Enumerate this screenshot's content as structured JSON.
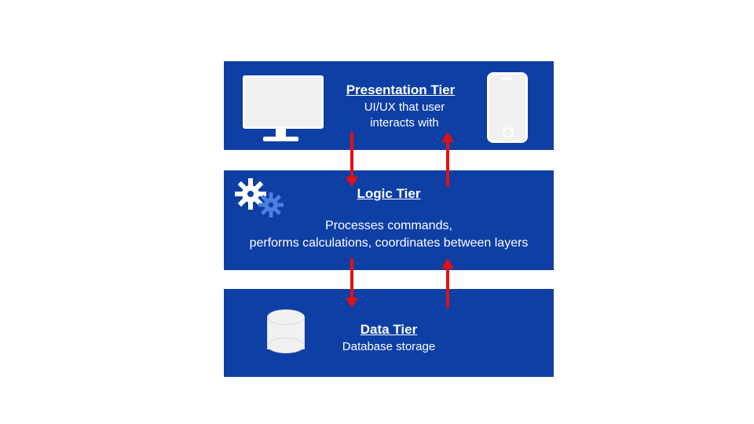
{
  "tiers": {
    "presentation": {
      "title": " Presentation Tier",
      "desc": "UI/UX that user interacts with"
    },
    "logic": {
      "title": "Logic Tier",
      "desc": "Processes commands,\nperforms calculations, coordinates between layers"
    },
    "data": {
      "title": "Data Tier",
      "desc": "Database storage"
    }
  },
  "colors": {
    "tier_bg": "#0e3fa5",
    "arrow": "#e31010",
    "gear_secondary": "#4e7ee0"
  }
}
